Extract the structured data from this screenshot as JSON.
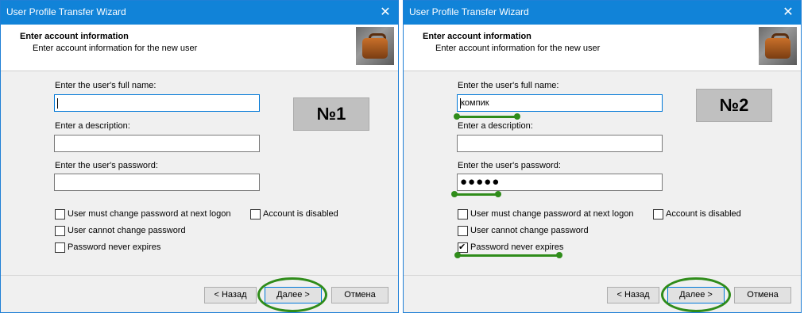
{
  "window1": {
    "title": "User Profile Transfer Wizard",
    "close_glyph": "✕",
    "header_title": "Enter account information",
    "header_subtitle": "Enter account information for the new user",
    "fullname_label": "Enter the user's full name:",
    "fullname_value": "",
    "description_label": "Enter a description:",
    "description_value": "",
    "password_label": "Enter the user's password:",
    "password_value": "",
    "checkboxes": [
      {
        "label": "User must change password at next logon",
        "checked": false
      },
      {
        "label": "Account is disabled",
        "checked": false
      },
      {
        "label": "User cannot change password",
        "checked": false
      },
      {
        "label": "Password never expires",
        "checked": false
      }
    ],
    "badge": "№1",
    "back_button": "< Назад",
    "next_button": "Далее >",
    "cancel_button": "Отмена"
  },
  "window2": {
    "title": "User Profile Transfer Wizard",
    "close_glyph": "✕",
    "header_title": "Enter account information",
    "header_subtitle": "Enter account information for the new user",
    "fullname_label": "Enter the user's full name:",
    "fullname_value": "компик",
    "description_label": "Enter a description:",
    "description_value": "",
    "password_label": "Enter the user's password:",
    "password_value": "●●●●●",
    "checkboxes": [
      {
        "label": "User must change password at next logon",
        "checked": false
      },
      {
        "label": "Account is disabled",
        "checked": false
      },
      {
        "label": "User cannot change password",
        "checked": false
      },
      {
        "label": "Password never expires",
        "checked": true
      }
    ],
    "badge": "№2",
    "back_button": "< Назад",
    "next_button": "Далее >",
    "cancel_button": "Отмена"
  },
  "colors": {
    "titlebar": "#1183d8",
    "annotation": "#2f8c1a"
  },
  "icons": {
    "header_image": "briefcase-icon",
    "close": "close-icon",
    "checkmark": "checkmark-icon"
  }
}
